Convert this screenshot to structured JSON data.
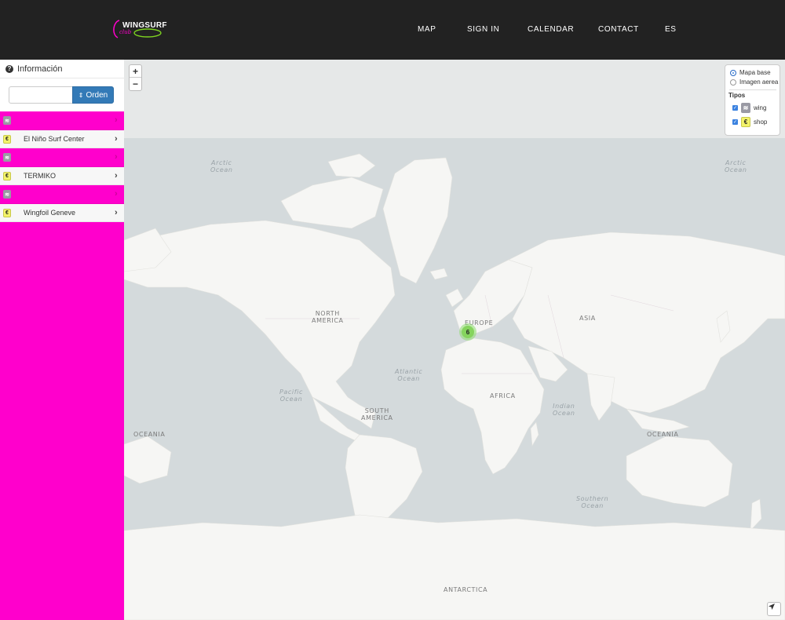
{
  "header": {
    "logo_text": "WINGSURF",
    "logo_sub": "club",
    "nav": [
      "MAP",
      "SIGN IN",
      "CALENDAR",
      "CONTACT",
      "ES"
    ]
  },
  "sidebar": {
    "title": "Información",
    "search_placeholder": "",
    "order_label": "Orden",
    "items": [
      {
        "label": "",
        "type": "wing"
      },
      {
        "label": "El Niño Surf Center",
        "type": "shop"
      },
      {
        "label": "",
        "type": "wing"
      },
      {
        "label": "TERMIKO",
        "type": "shop"
      },
      {
        "label": "",
        "type": "wing"
      },
      {
        "label": "Wingfoil Geneve",
        "type": "shop"
      }
    ]
  },
  "map": {
    "zoom_in": "+",
    "zoom_out": "−",
    "layers": {
      "base": "Mapa base",
      "aerial": "Imagen aerea",
      "types_title": "Tipos",
      "types": [
        "wing",
        "shop"
      ]
    },
    "cluster_count": "6",
    "labels": {
      "arctic_left": "Arctic\nOcean",
      "arctic_right": "Arctic\nOcean",
      "north_america": "NORTH\nAMERICA",
      "europe": "EUROPE",
      "asia": "ASIA",
      "atlantic": "Atlantic\nOcean",
      "africa": "AFRICA",
      "pacific": "Pacific\nOcean",
      "south_america": "SOUTH\nAMERICA",
      "indian": "Indian\nOcean",
      "oceania_left": "OCEANIA",
      "oceania_right": "OCEANIA",
      "southern": "Southern\nOcean",
      "antarctica": "ANTARCTICA"
    }
  },
  "colors": {
    "header_bg": "#222222",
    "sidebar_bg": "#ff00cc",
    "accent": "#337ab7",
    "cluster": "#86d45e"
  }
}
